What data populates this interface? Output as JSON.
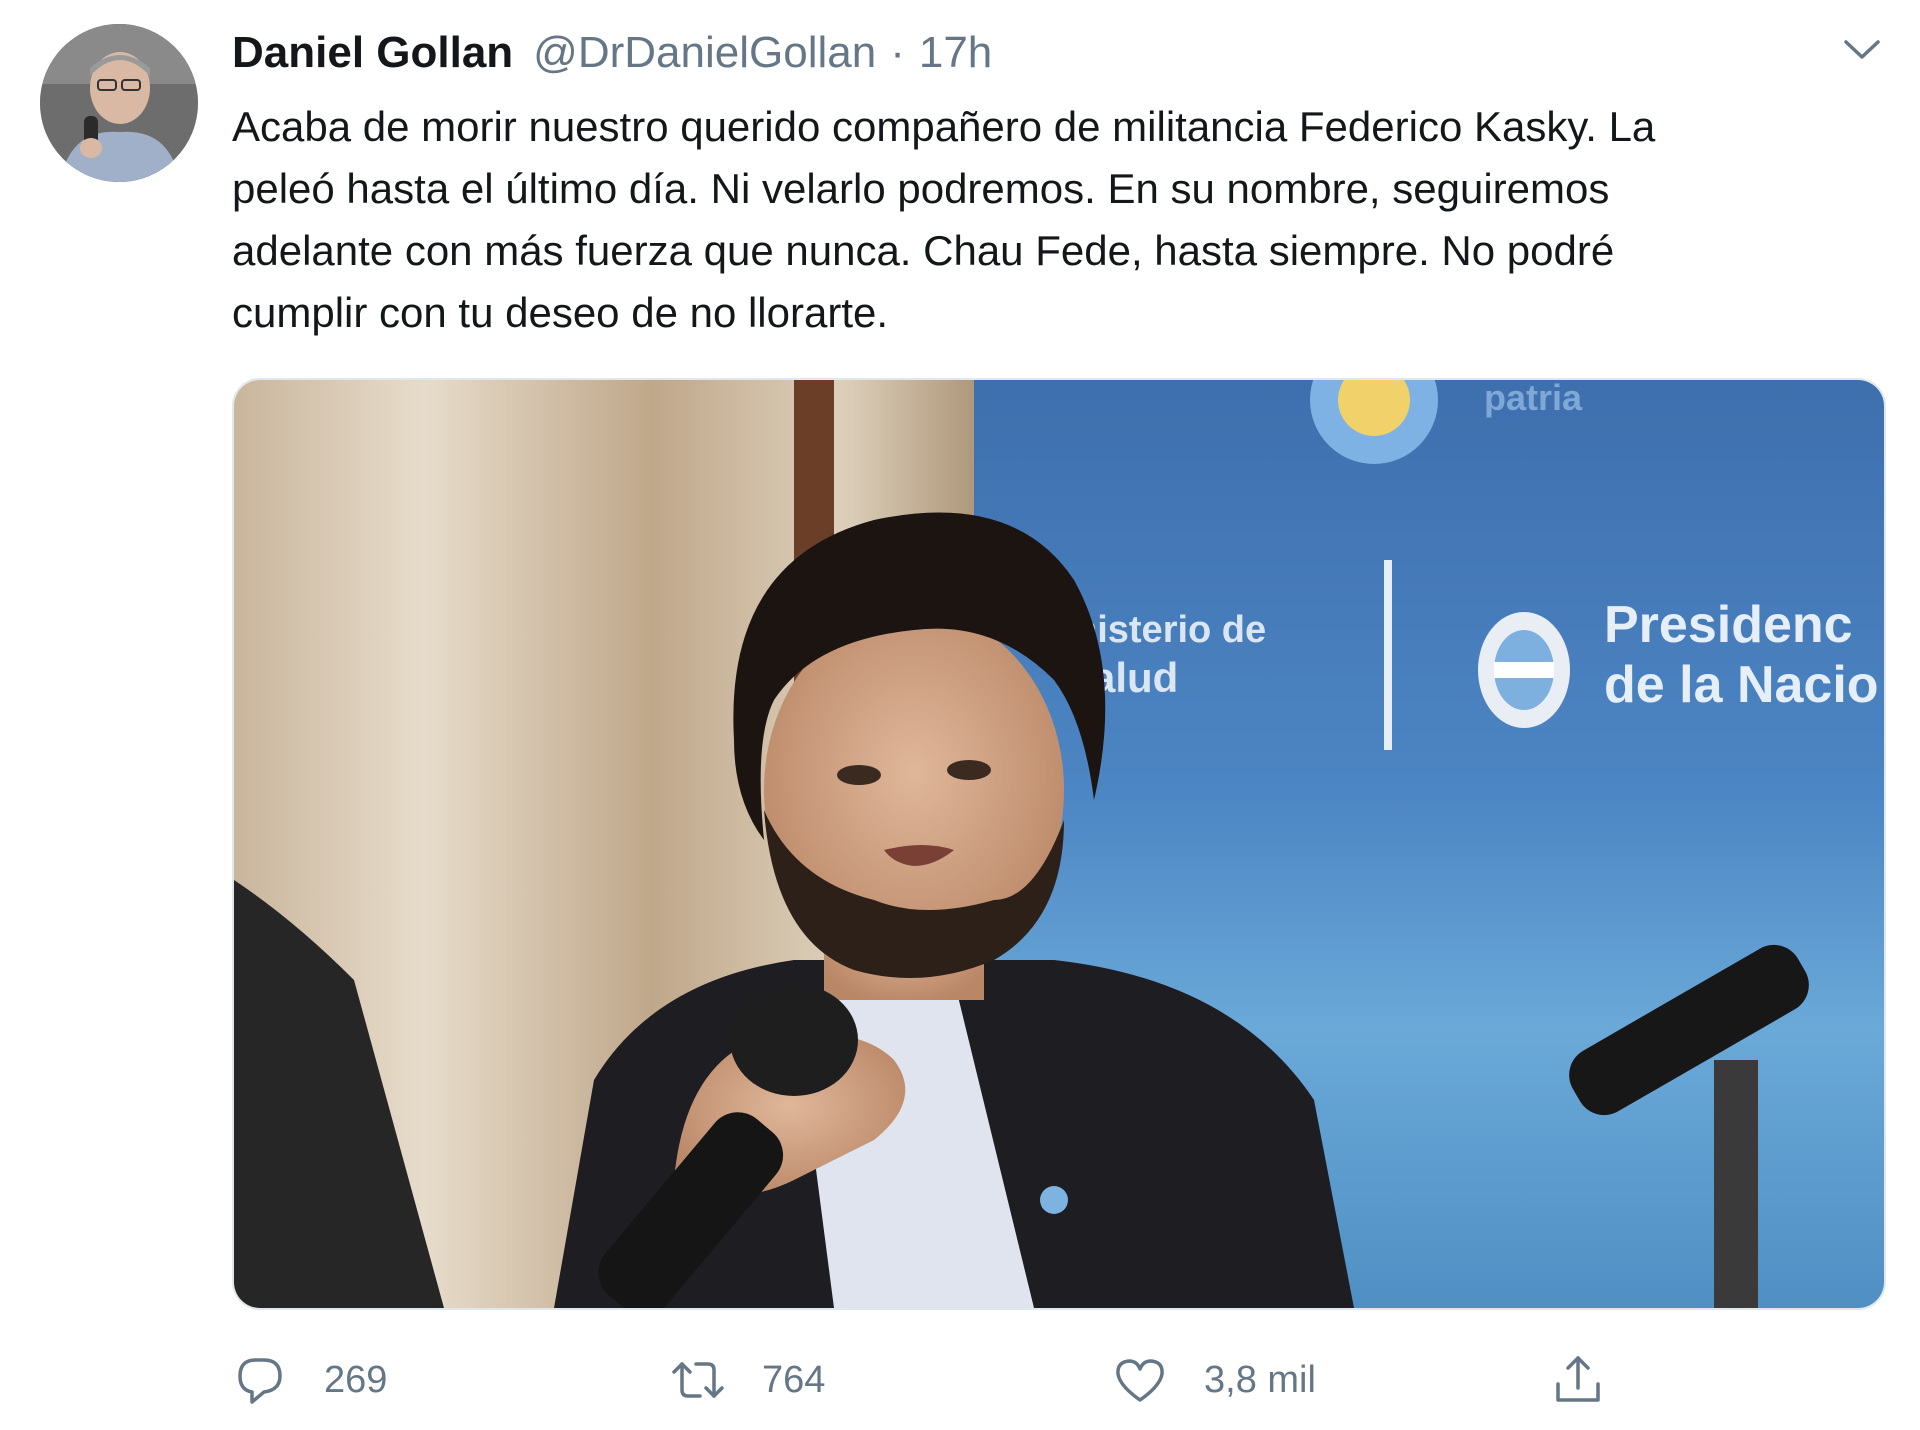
{
  "author": {
    "display_name": "Daniel Gollan",
    "handle": "@DrDanielGollan",
    "separator": "·",
    "time": "17h"
  },
  "tweet": {
    "lines": [
      "Acaba de morir nuestro querido compañero de militancia Federico Kasky. La",
      "peleó hasta el último día. Ni velarlo podremos. En su nombre, seguiremos",
      "adelante con más fuerza que nunca. Chau Fede, hasta siempre. No podré",
      "cumplir con tu deseo de no llorarte."
    ]
  },
  "media": {
    "banner_text": {
      "top": "patria",
      "ministry_line1": "nisterio de",
      "ministry_line2": "alud",
      "presidency_line1": "Presidenc",
      "presidency_line2": "de la Nacio"
    }
  },
  "actions": {
    "reply_count": "269",
    "retweet_count": "764",
    "like_count": "3,8 mil"
  },
  "icons": {
    "caret": "chevron-down-icon",
    "reply": "reply-icon",
    "retweet": "retweet-icon",
    "like": "heart-icon",
    "share": "share-icon"
  },
  "colors": {
    "text": "#14171a",
    "secondary": "#657786",
    "banner_blue": "#3f73b6"
  }
}
